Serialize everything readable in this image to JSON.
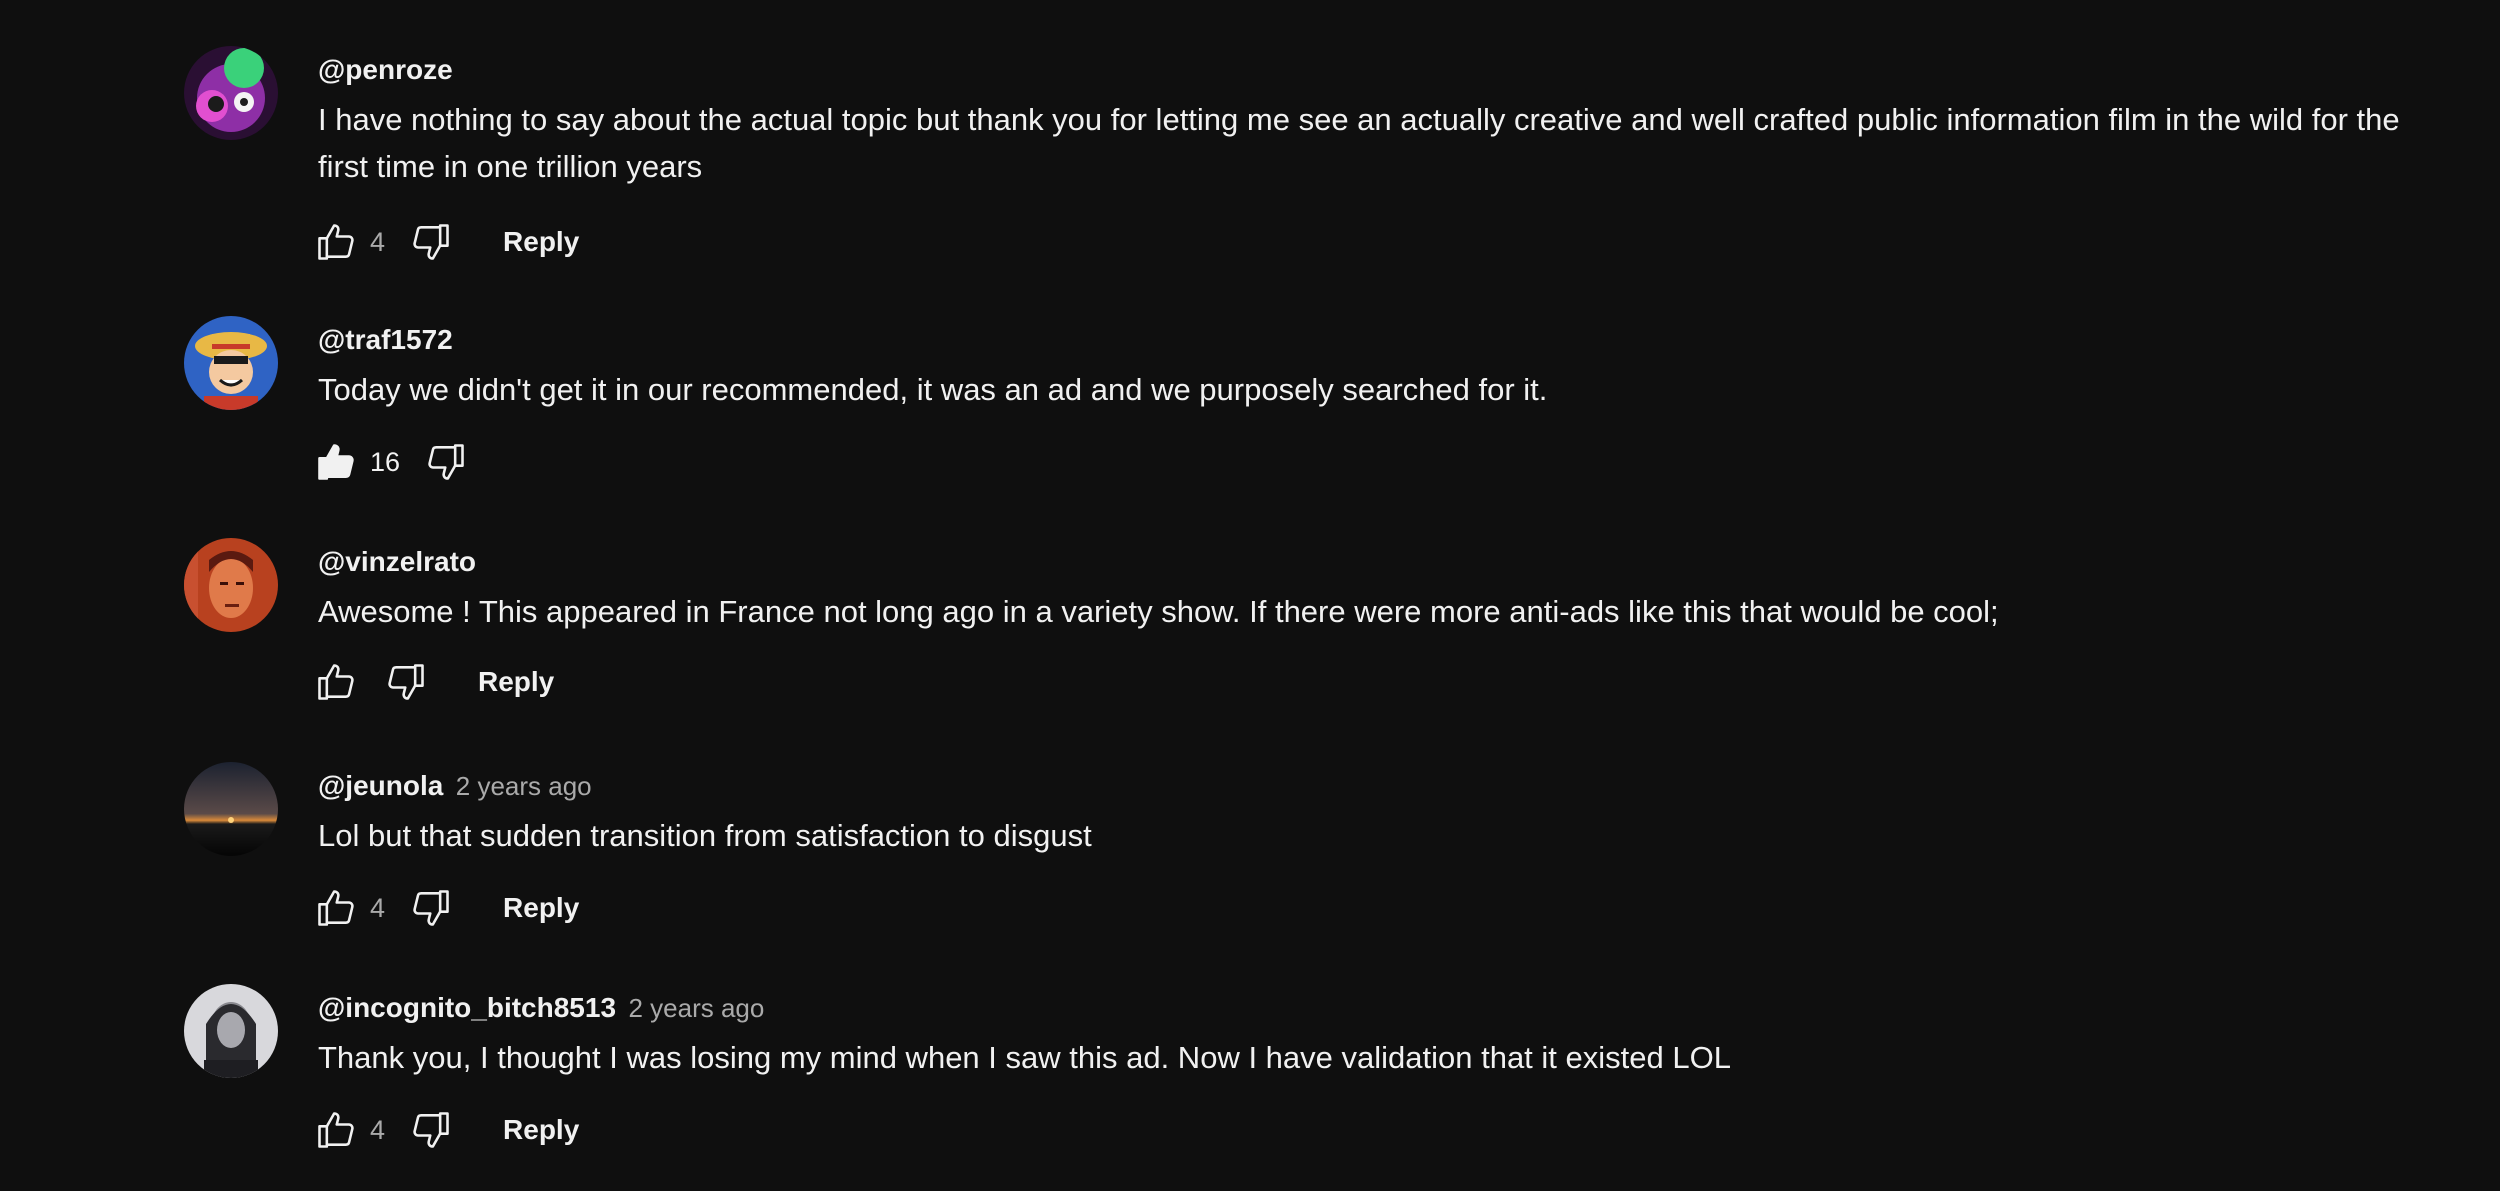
{
  "comments": [
    {
      "author": "@penroze",
      "time": "",
      "text": "I have nothing to say about the actual topic but thank you for letting me see an actually creative and well crafted public information film in the wild for the first time in one trillion years",
      "likes": "4",
      "liked": false,
      "reply_label": "Reply",
      "avatar_colors": [
        "#7b2a8c",
        "#3ad17a",
        "#e24fd0"
      ]
    },
    {
      "author": "@traf1572",
      "time": "",
      "text": "Today we didn't get it in our recommended, it was an ad and we purposely searched for it.",
      "likes": "16",
      "liked": true,
      "reply_label": "",
      "avatar_colors": [
        "#3a6fd0",
        "#f4c9a0",
        "#c83a2a"
      ]
    },
    {
      "author": "@vinzelrato",
      "time": "",
      "text": "Awesome ! This appeared in France not long ago in a variety show. If there were more anti-ads like this that would be cool;",
      "likes": "",
      "liked": false,
      "reply_label": "Reply",
      "avatar_colors": [
        "#b8411f",
        "#e07a4a",
        "#5a1a10"
      ]
    },
    {
      "author": "@jeunola",
      "time": "2 years ago",
      "text": "Lol but that sudden transition from satisfaction to disgust",
      "likes": "4",
      "liked": false,
      "reply_label": "Reply",
      "avatar_colors": [
        "#1c2230",
        "#d98a3a",
        "#0a0a0a"
      ]
    },
    {
      "author": "@incognito_bitch8513",
      "time": "2 years ago",
      "text": "Thank you, I thought I was losing my mind when I saw this ad. Now I have validation that it existed LOL",
      "likes": "4",
      "liked": false,
      "reply_label": "Reply",
      "avatar_colors": [
        "#d8d8dc",
        "#2a2a2e",
        "#8a8a90"
      ]
    }
  ],
  "icons": {
    "like": "thumbs-up-icon",
    "dislike": "thumbs-down-icon"
  }
}
